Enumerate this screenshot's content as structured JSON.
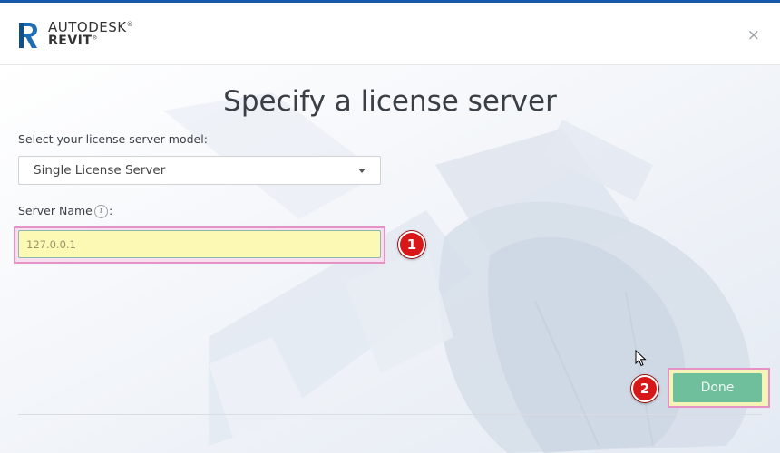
{
  "header": {
    "brand_top": "AUTODESK",
    "brand_top_mark": "®",
    "product": "REVIT",
    "product_mark": "®",
    "close_glyph": "×"
  },
  "main": {
    "title": "Specify a license server",
    "model_label": "Select your license server model:",
    "model_select": {
      "value": "Single License Server"
    },
    "server_name_label": "Server Name",
    "info_glyph": "i",
    "colon": ":",
    "server_input": {
      "value": "127.0.0.1"
    }
  },
  "annotations": {
    "marker_1": "1",
    "marker_2": "2"
  },
  "footer": {
    "done_label": "Done"
  },
  "icons": {
    "logo": "revit-logo-icon",
    "close": "close-icon",
    "info": "info-icon",
    "caret": "chevron-down-icon",
    "cursor": "mouse-cursor-icon"
  },
  "colors": {
    "accent_strip": "#1858a8",
    "done_button": "#6fbf9d",
    "input_fill": "#fbf9b4",
    "marker_red": "#d81818",
    "highlight_border": "#e592c7"
  }
}
